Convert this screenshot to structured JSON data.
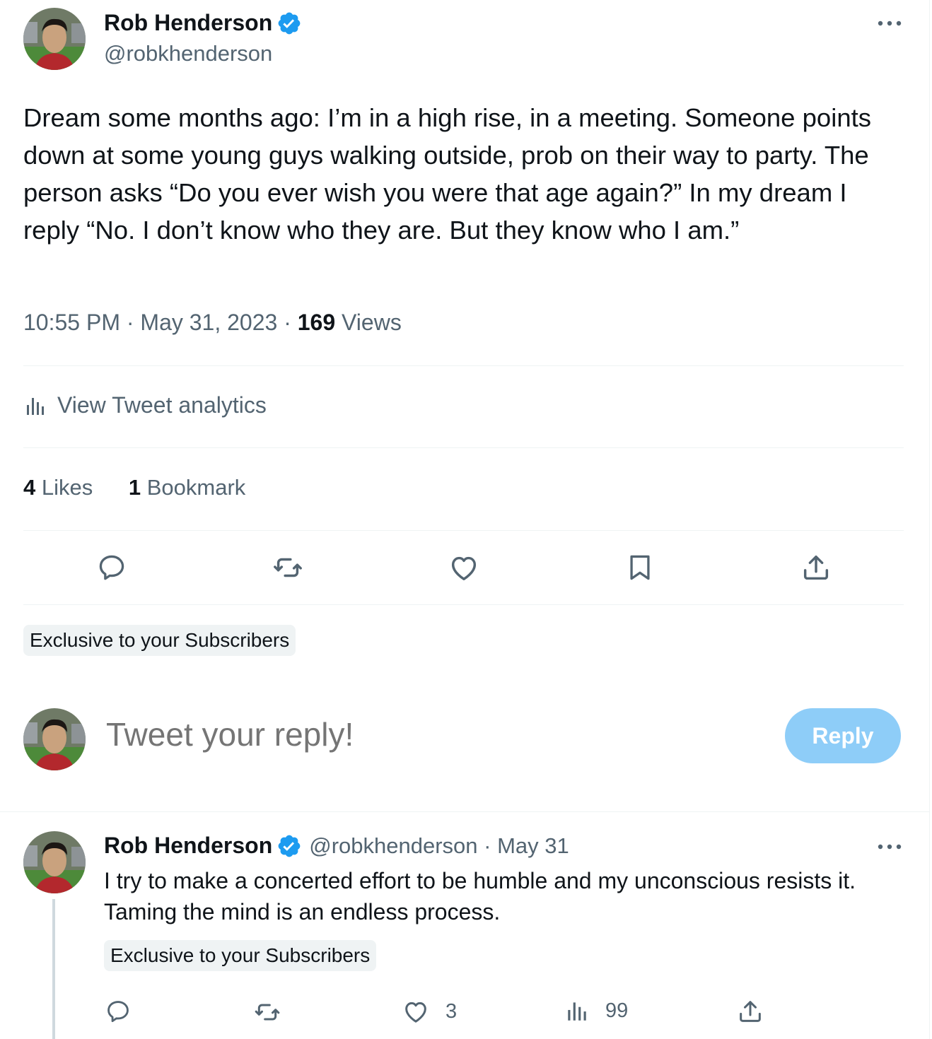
{
  "tweet": {
    "author_name": "Rob Henderson",
    "author_handle": "@robkhenderson",
    "text": "Dream some months ago: I’m in a high rise, in a meeting. Someone points down at some young guys walking outside, prob on their way to party. The person asks “Do you ever wish you were that age again?” In my dream I reply “No. I don’t know who they are. But they know who I am.”",
    "time": "10:55 PM",
    "date": "May 31, 2023",
    "views_count": "169",
    "views_label": "Views",
    "analytics_label": "View Tweet analytics",
    "likes_count": "4",
    "likes_label": "Likes",
    "bookmarks_count": "1",
    "bookmarks_label": "Bookmark",
    "exclusive_label": "Exclusive to your Subscribers",
    "icons": [
      "more-icon",
      "reply-icon",
      "retweet-icon",
      "like-icon",
      "bookmark-icon",
      "share-icon",
      "analytics-icon",
      "verified-badge-icon"
    ]
  },
  "composer": {
    "placeholder": "Tweet your reply!",
    "reply_button": "Reply"
  },
  "thread_reply": {
    "author_name": "Rob Henderson",
    "author_handle": "@robkhenderson",
    "date": "May 31",
    "text": "I try to make a concerted effort to be humble and my unconscious resists it. Taming the mind is an endless process.",
    "exclusive_label": "Exclusive to your Subscribers",
    "like_count": "3",
    "view_count": "99"
  },
  "colors": {
    "text_primary": "#0f1419",
    "text_secondary": "#536471",
    "verified_blue": "#1d9bf0",
    "reply_button_disabled": "#8ecdf8",
    "divider": "#eff3f4",
    "thread_line": "#cfd9de"
  }
}
